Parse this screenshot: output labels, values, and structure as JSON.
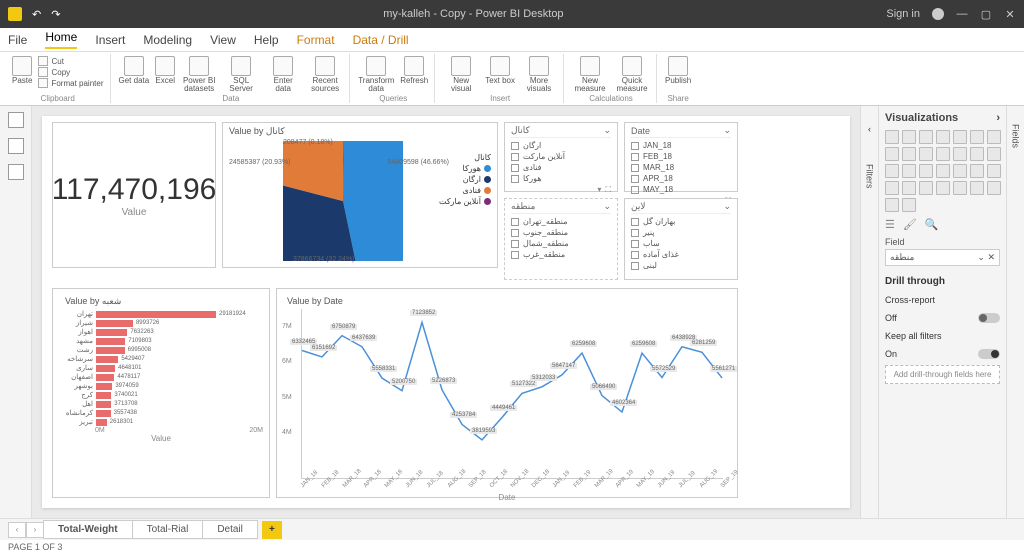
{
  "titlebar": {
    "title": "my-kalleh - Copy - Power BI Desktop",
    "signin": "Sign in"
  },
  "menu": {
    "file": "File",
    "home": "Home",
    "insert": "Insert",
    "modeling": "Modeling",
    "view": "View",
    "help": "Help",
    "format": "Format",
    "datadrill": "Data / Drill"
  },
  "ribbon": {
    "clipboard": {
      "label": "Clipboard",
      "paste": "Paste",
      "cut": "Cut",
      "copy": "Copy",
      "painter": "Format painter"
    },
    "data": {
      "label": "Data",
      "getdata": "Get data",
      "excel": "Excel",
      "pbids": "Power BI datasets",
      "sql": "SQL Server",
      "enter": "Enter data",
      "sources": "Recent sources"
    },
    "queries": {
      "label": "Queries",
      "transform": "Transform data",
      "refresh": "Refresh"
    },
    "insert": {
      "label": "Insert",
      "newvis": "New visual",
      "textbox": "Text box",
      "morevis": "More visuals"
    },
    "calc": {
      "label": "Calculations",
      "newmeas": "New measure",
      "quickmeas": "Quick measure"
    },
    "share": {
      "label": "Share",
      "publish": "Publish"
    }
  },
  "vizpane": {
    "title": "Visualizations",
    "field": "Field",
    "fieldval": "منطقه",
    "drill": "Drill through",
    "cross": "Cross-report",
    "off": "Off",
    "keep": "Keep all filters",
    "on": "On",
    "addfield": "Add drill-through fields here"
  },
  "filters": {
    "label": "Filters"
  },
  "fields": {
    "label": "Fields"
  },
  "card": {
    "value": "117,470,196",
    "label": "Value"
  },
  "pie": {
    "title": "Value by کانال",
    "legend_title": "کانال",
    "slices": [
      {
        "label": "هورکا",
        "value": 54809598,
        "pct": "46.66%",
        "color": "#2e8bd8"
      },
      {
        "label": "ارگان",
        "value": 37866734,
        "pct": "32.24%",
        "color": "#1b3a6b"
      },
      {
        "label": "فنادی",
        "value": 24585387,
        "pct": "20.93%",
        "color": "#e07b3a"
      },
      {
        "label": "آنلاین مارکت",
        "value": 208477,
        "pct": "0.18%",
        "color": "#7a2e7a"
      }
    ]
  },
  "slicer_channel": {
    "title": "کانال",
    "items": [
      "ارگان",
      "آنلاین مارکت",
      "فنادی",
      "هورکا"
    ]
  },
  "slicer_date": {
    "title": "Date",
    "items": [
      "JAN_18",
      "FEB_18",
      "MAR_18",
      "APR_18",
      "MAY_18"
    ]
  },
  "slicer_region": {
    "title": "منطقه",
    "items": [
      "منطقه_تهران",
      "منطقه_جنوب",
      "منطقه_شمال",
      "منطقه_غرب"
    ]
  },
  "slicer_line": {
    "title": "لاین",
    "items": [
      "بهاران گل",
      "پنیر",
      "ساب",
      "غذای آماده",
      "لبنی",
      "غذای آماده"
    ]
  },
  "bar": {
    "title": "Value by شعبه",
    "ylabel": "شعبه",
    "xlabel": "Value",
    "xticks": [
      "0M",
      "20M"
    ],
    "items": [
      {
        "label": "تهران",
        "value": 29181924
      },
      {
        "label": "شیراز",
        "value": 8993726
      },
      {
        "label": "اهواز",
        "value": 7632263
      },
      {
        "label": "مشهد",
        "value": 7109803
      },
      {
        "label": "رشت",
        "value": 6995008
      },
      {
        "label": "سرشاخه",
        "value": 5429407
      },
      {
        "label": "ساری",
        "value": 4648101
      },
      {
        "label": "اصفهان",
        "value": 4478117
      },
      {
        "label": "بوشهر",
        "value": 3974059
      },
      {
        "label": "کرج",
        "value": 3740021
      },
      {
        "label": "اهل",
        "value": 3713708
      },
      {
        "label": "کرمانشاه",
        "value": 3557438
      },
      {
        "label": "تبریز",
        "value": 2618301
      }
    ]
  },
  "chart_data": {
    "type": "line",
    "title": "Value by Date",
    "xlabel": "Date",
    "ylabel": "Value",
    "ylim": [
      3000000,
      7500000
    ],
    "yticks": [
      "4M",
      "5M",
      "6M",
      "7M"
    ],
    "categories": [
      "JAN_18",
      "FEB_18",
      "MAR_18",
      "APR_18",
      "MAY_18",
      "JUN_18",
      "JUL_18",
      "AUG_18",
      "SEP_18",
      "OCT_18",
      "NOV_18",
      "DEC_18",
      "JAN_19",
      "FEB_19",
      "MAR_19",
      "APR_19",
      "MAY_19",
      "JUN_19",
      "JUL_19",
      "AUG_19",
      "SEP_19"
    ],
    "values": [
      6332465,
      6151692,
      6750879,
      6437639,
      5558331,
      5200750,
      7123852,
      5226873,
      4253784,
      3819593,
      4449461,
      5127322,
      5312033,
      5647147,
      6259608,
      5066490,
      4602364,
      6259608,
      5572529,
      6438928,
      6281259,
      5561271
    ]
  },
  "tabs": {
    "t1": "Total-Weight",
    "t2": "Total-Rial",
    "t3": "Detail"
  },
  "status": {
    "page": "PAGE 1 OF 3"
  }
}
